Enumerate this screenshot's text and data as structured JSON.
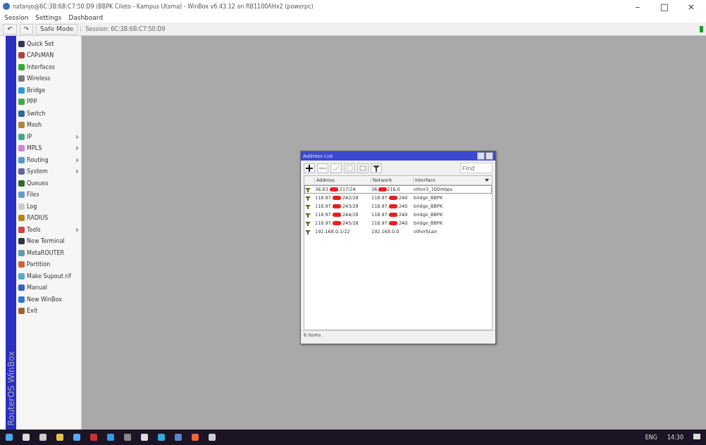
{
  "window": {
    "title": "natanjo@6C:3B:6B:C7:50:D9 (BBPK Cileto - Kampus Utama) - WinBox v6.43.12 on RB1100AHx2 (powerpc)",
    "controls": [
      "–",
      "□",
      "×"
    ]
  },
  "menu": [
    "Session",
    "Settings",
    "Dashboard"
  ],
  "toolbar": {
    "undo": "↶",
    "redo": "↷",
    "safe_mode": "Safe Mode",
    "session": "Session: 6C:3B:6B:C7:50:D9"
  },
  "sidebar": {
    "brand": "RouterOS WinBox",
    "items": [
      {
        "label": "Quick Set",
        "submenu": false
      },
      {
        "label": "CAPsMAN",
        "submenu": false
      },
      {
        "label": "Interfaces",
        "submenu": false
      },
      {
        "label": "Wireless",
        "submenu": false
      },
      {
        "label": "Bridge",
        "submenu": false
      },
      {
        "label": "PPP",
        "submenu": false
      },
      {
        "label": "Switch",
        "submenu": false
      },
      {
        "label": "Mesh",
        "submenu": false
      },
      {
        "label": "IP",
        "submenu": true
      },
      {
        "label": "MPLS",
        "submenu": true
      },
      {
        "label": "Routing",
        "submenu": true
      },
      {
        "label": "System",
        "submenu": true
      },
      {
        "label": "Queues",
        "submenu": false
      },
      {
        "label": "Files",
        "submenu": false
      },
      {
        "label": "Log",
        "submenu": false
      },
      {
        "label": "RADIUS",
        "submenu": false
      },
      {
        "label": "Tools",
        "submenu": true
      },
      {
        "label": "New Terminal",
        "submenu": false
      },
      {
        "label": "MetaROUTER",
        "submenu": false
      },
      {
        "label": "Partition",
        "submenu": false
      },
      {
        "label": "Make Supout.rif",
        "submenu": false
      },
      {
        "label": "Manual",
        "submenu": false
      },
      {
        "label": "New WinBox",
        "submenu": false
      },
      {
        "label": "Exit",
        "submenu": false
      }
    ]
  },
  "address_list": {
    "title": "Address List",
    "find_placeholder": "Find",
    "columns": [
      "Address",
      "Network",
      "Interface"
    ],
    "rows": [
      {
        "address_start": "36.83.",
        "address_end": ".217/24",
        "network_start": "36.",
        "network_end": "216.0",
        "interface": "ether3_100mbps",
        "selected": true
      },
      {
        "address_start": "118.97.",
        "address_end": ".242/28",
        "network_start": "118.97.",
        "network_end": ".240",
        "interface": "bridge_BBPK",
        "selected": false
      },
      {
        "address_start": "118.97.",
        "address_end": ".243/28",
        "network_start": "118.97.",
        "network_end": ".240",
        "interface": "bridge_BBPK",
        "selected": false
      },
      {
        "address_start": "118.97.",
        "address_end": ".244/28",
        "network_start": "118.97.",
        "network_end": ".240",
        "interface": "bridge_BBPK",
        "selected": false
      },
      {
        "address_start": "118.97.",
        "address_end": ".245/28",
        "network_start": "118.97.",
        "network_end": ".240",
        "interface": "bridge_BBPK",
        "selected": false
      },
      {
        "address_start": "192.168.0.1/22",
        "address_end": "",
        "network_start": "192.168.0.0",
        "network_end": "",
        "interface": "etherSLan",
        "selected": false
      }
    ],
    "status": "6 items"
  },
  "taskbar": {
    "language": "ENG",
    "time": "14:30"
  }
}
